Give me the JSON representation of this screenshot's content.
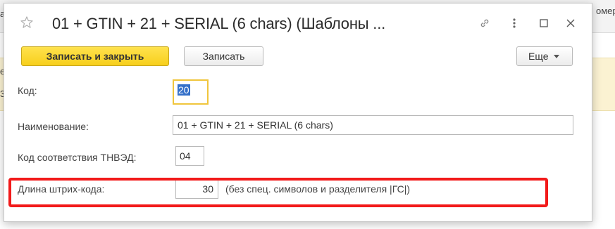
{
  "background": {
    "left_fragment": "а",
    "right_fragment": "омер",
    "strip_left_1": "е",
    "strip_left_2": "38"
  },
  "dialog": {
    "title": "01 + GTIN + 21 + SERIAL (6 chars) (Шаблоны ...",
    "icons": [
      "star-icon",
      "link-icon",
      "more-vertical-icon",
      "maximize-icon",
      "close-icon"
    ]
  },
  "toolbar": {
    "save_close_label": "Записать и закрыть",
    "save_label": "Записать",
    "more_label": "Еще"
  },
  "form": {
    "code_label": "Код:",
    "code_value": "20",
    "name_label": "Наименование:",
    "name_value": "01 + GTIN + 21 + SERIAL (6 chars)",
    "tnved_label": "Код соответствия ТНВЭД:",
    "tnved_value": "04",
    "barcode_len_label": "Длина штрих-кода:",
    "barcode_len_value": "30",
    "barcode_len_note": "(без спец. символов и разделителя |ГС|)"
  },
  "colors": {
    "primary_button": "#f7cf1c",
    "highlight_border": "#f21a1a",
    "focus_border": "#f0c53c",
    "selection": "#3470c9"
  }
}
